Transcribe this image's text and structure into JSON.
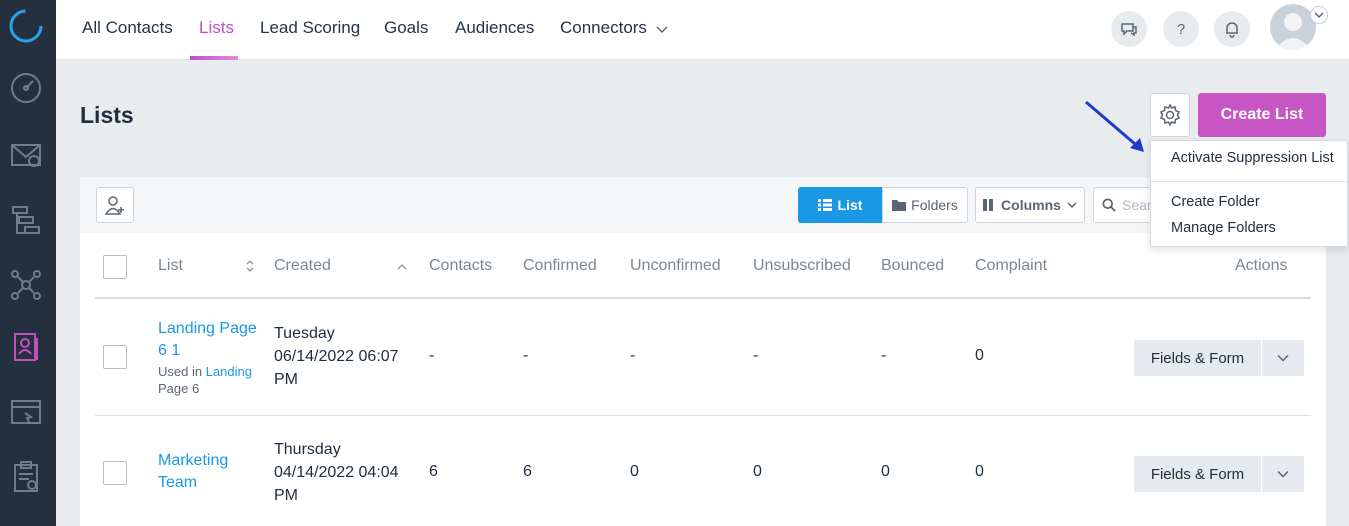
{
  "nav": {
    "items": [
      "All Contacts",
      "Lists",
      "Lead Scoring",
      "Goals",
      "Audiences",
      "Connectors"
    ],
    "active": "Lists",
    "accent_color": "#c24fbf"
  },
  "header": {
    "icons": [
      "chat-icon",
      "help-icon",
      "bell-icon"
    ],
    "help_label": "?"
  },
  "page": {
    "title": "Lists",
    "create_button": "Create List"
  },
  "settings_menu": {
    "items": [
      "Activate Suppression List",
      "Create Folder",
      "Manage Folders"
    ]
  },
  "toolbar": {
    "view_list": "List",
    "view_folders": "Folders",
    "columns": "Columns",
    "search_placeholder": "Search"
  },
  "table": {
    "headers": [
      "List",
      "Created",
      "Contacts",
      "Confirmed",
      "Unconfirmed",
      "Unsubscribed",
      "Bounced",
      "Complaint",
      "Actions"
    ],
    "rows": [
      {
        "name_line1": "Landing Page",
        "name_line2": "6 1",
        "used_prefix": "Used in",
        "used_link1": "Landing",
        "used_link2": "Page 6",
        "created_day": "Tuesday",
        "created_date": "06/14/2022 06:07",
        "created_ampm": "PM",
        "contacts": "-",
        "confirmed": "-",
        "unconfirmed": "-",
        "unsubscribed": "-",
        "bounced": "-",
        "complaint": "0",
        "action": "Fields & Form"
      },
      {
        "name_line1": "Marketing",
        "name_line2": "Team",
        "created_day": "Thursday",
        "created_date": "04/14/2022 04:04",
        "created_ampm": "PM",
        "contacts": "6",
        "confirmed": "6",
        "unconfirmed": "0",
        "unsubscribed": "0",
        "bounced": "0",
        "complaint": "0",
        "action": "Fields & Form"
      }
    ]
  },
  "colors": {
    "primary_button": "#c756c4",
    "link": "#1a98e6",
    "sidebar": "#24303d"
  }
}
